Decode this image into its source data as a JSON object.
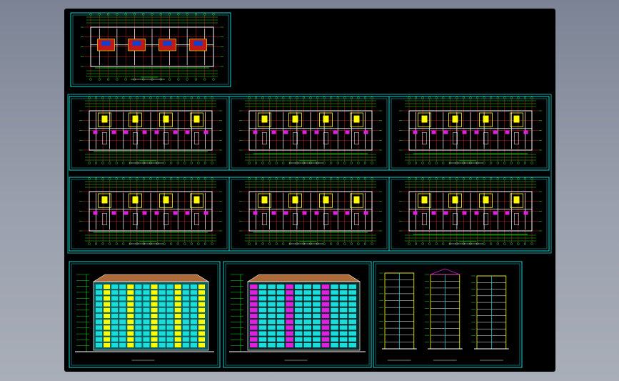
{
  "viewer": {
    "background": "#8c93a3",
    "canvas_color": "#000000"
  },
  "colors": {
    "frame": "#19d4d4",
    "wall": "#ffffff",
    "axis": "#e02020",
    "dim": "#22e022",
    "accent": "#ffff00",
    "magenta": "#e020e0",
    "facade": "#1adede",
    "roof": "#b06a3a"
  },
  "sheets": [
    {
      "id": "site-plan",
      "kind": "plan",
      "variant": "site"
    },
    {
      "id": "floor-plan-1",
      "kind": "plan",
      "variant": "a"
    },
    {
      "id": "floor-plan-2",
      "kind": "plan",
      "variant": "b"
    },
    {
      "id": "floor-plan-3",
      "kind": "plan",
      "variant": "b"
    },
    {
      "id": "floor-plan-4",
      "kind": "plan",
      "variant": "a"
    },
    {
      "id": "floor-plan-5",
      "kind": "plan",
      "variant": "a"
    },
    {
      "id": "floor-plan-6",
      "kind": "plan",
      "variant": "b"
    },
    {
      "id": "front-elevation",
      "kind": "elevation",
      "variant": "front"
    },
    {
      "id": "rear-elevation",
      "kind": "elevation",
      "variant": "rear"
    },
    {
      "id": "sections",
      "kind": "section",
      "variant": "multi"
    }
  ]
}
